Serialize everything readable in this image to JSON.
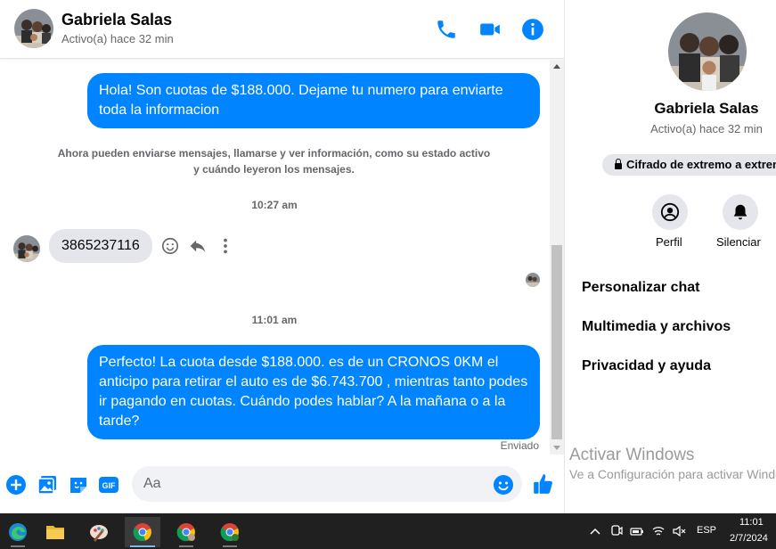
{
  "header": {
    "name": "Gabriela Salas",
    "status": "Activo(a) hace 32 min"
  },
  "messages": {
    "out1": "Hola! Son cuotas de $188.000. Dejame tu numero para enviarte toda la informacion",
    "system": "Ahora pueden enviarse mensajes, llamarse y ver información, como su estado activo y cuándo leyeron los mensajes.",
    "time1": "10:27 am",
    "in1": "3865237116",
    "time2": "11:01 am",
    "out2": "Perfecto! La cuota desde $188.000. es de un CRONOS 0KM el anticipo para retirar el auto es de $6.743.700 , mientras tanto podes ir pagando en cuotas. Cuándo podes hablar? A la mañana o a la tarde?",
    "sent_status": "Enviado"
  },
  "composer": {
    "placeholder": "Aa"
  },
  "side": {
    "name": "Gabriela Salas",
    "status": "Activo(a) hace 32 min",
    "encryption": "Cifrado de extremo a extremo",
    "profile_label": "Perfil",
    "mute_label": "Silenciar",
    "items": [
      "Personalizar chat",
      "Multimedia y archivos",
      "Privacidad y ayuda"
    ]
  },
  "watermark": {
    "title": "Activar Windows",
    "subtitle": "Ve a Configuración para activar Windows."
  },
  "taskbar": {
    "lang": "ESP",
    "time": "11:01",
    "date": "2/7/2024"
  },
  "colors": {
    "accent": "#0084ff",
    "bubble_in": "#e4e6eb",
    "taskbar": "#202020"
  }
}
